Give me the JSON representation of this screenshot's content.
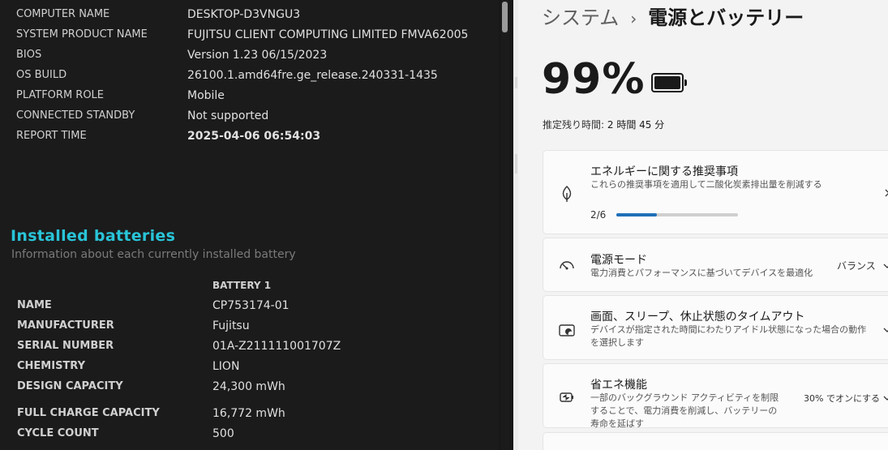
{
  "report": {
    "system_rows": [
      {
        "label": "COMPUTER NAME",
        "value": "DESKTOP-D3VNGU3"
      },
      {
        "label": "SYSTEM PRODUCT NAME",
        "value": "FUJITSU CLIENT COMPUTING LIMITED FMVA62005"
      },
      {
        "label": "BIOS",
        "value": "Version 1.23 06/15/2023"
      },
      {
        "label": "OS BUILD",
        "value": "26100.1.amd64fre.ge_release.240331-1435"
      },
      {
        "label": "PLATFORM ROLE",
        "value": "Mobile"
      },
      {
        "label": "CONNECTED STANDBY",
        "value": "Not supported"
      },
      {
        "label": "REPORT TIME",
        "value": "2025-04-06  06:54:03"
      }
    ],
    "installed_title": "Installed batteries",
    "installed_subtitle": "Information about each currently installed battery",
    "battery_column": "BATTERY 1",
    "battery_rows": [
      {
        "label": "NAME",
        "value": "CP753174-01"
      },
      {
        "label": "MANUFACTURER",
        "value": "Fujitsu"
      },
      {
        "label": "SERIAL NUMBER",
        "value": "01A-Z211111001707Z"
      },
      {
        "label": "CHEMISTRY",
        "value": "LION"
      },
      {
        "label": "DESIGN CAPACITY",
        "value": "24,300 mWh"
      },
      {
        "label": "FULL CHARGE CAPACITY",
        "value": "16,772 mWh"
      },
      {
        "label": "CYCLE COUNT",
        "value": "500"
      }
    ]
  },
  "settings": {
    "breadcrumb_parent": "システム",
    "breadcrumb_sep": "›",
    "breadcrumb_current": "電源とバッテリー",
    "battery_percent": "99%",
    "battery_level": 0.99,
    "remaining_label": "推定残り時間:",
    "remaining_value": "2 時間 45 分",
    "recommendations": {
      "title": "エネルギーに関する推奨事項",
      "desc": "これらの推奨事項を適用して二酸化炭素排出量を削減する",
      "progress_text": "2/6",
      "progress_fraction": 0.333,
      "icon": "leaf-icon"
    },
    "power_mode": {
      "title": "電源モード",
      "desc": "電力消費とパフォーマンスに基づいてデバイスを最適化",
      "value": "バランス",
      "icon": "gauge-icon"
    },
    "screen_sleep": {
      "title": "画面、スリープ、休止状態のタイムアウト",
      "desc": "デバイスが指定された時間にわたりアイドル状態になった場合の動作を選択します",
      "icon": "screen-sleep-icon"
    },
    "energy_saver": {
      "title": "省エネ機能",
      "desc": "一部のバックグラウンド アクティビティを制限することで、電力消費を削減し、バッテリーの寿命を延ばす",
      "value": "30% でオンにする",
      "icon": "energy-saver-icon"
    },
    "colors": {
      "accent": "#1f6fb8",
      "report_heading": "#29c4d8"
    }
  }
}
